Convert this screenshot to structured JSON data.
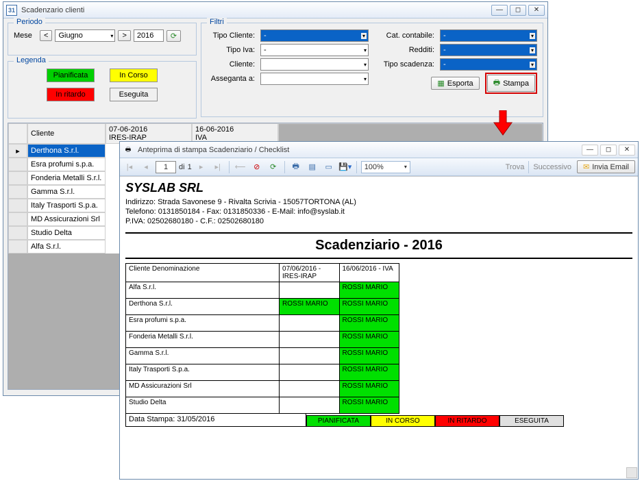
{
  "main": {
    "title": "Scadenzario clienti",
    "periodo": {
      "label": "Periodo",
      "mese_lbl": "Mese",
      "mese": "Giugno",
      "anno": "2016"
    },
    "legenda": {
      "label": "Legenda",
      "pianificata": "Pianificata",
      "incorso": "In Corso",
      "inritardo": "In ritardo",
      "eseguita": "Eseguita"
    },
    "filtri": {
      "label": "Filtri",
      "tipo_cliente": "Tipo Cliente:",
      "tipo_iva": "Tipo Iva:",
      "cliente": "Cliente:",
      "assegnata": "Asseganta a:",
      "cat_contabile": "Cat. contabile:",
      "redditi": "Redditi:",
      "tipo_scadenza": "Tipo scadenza:",
      "dash": "-"
    },
    "esporta": "Esporta",
    "stampa": "Stampa",
    "gridh": {
      "cliente": "Cliente",
      "c1a": "07-06-2016",
      "c1b": "IRES-IRAP",
      "c2a": "16-06-2016",
      "c2b": "IVA"
    },
    "rows": [
      "Derthona S.r.l.",
      "Esra profumi s.p.a.",
      "Fonderia Metalli  S.r.l.",
      "Gamma S.r.l.",
      "Italy Trasporti S.p.a.",
      "MD Assicurazioni Srl",
      "Studio Delta",
      "Alfa S.r.l."
    ]
  },
  "prev": {
    "title": "Anteprima di stampa Scadenziario / Checklist",
    "page_cur": "1",
    "di": "di",
    "page_tot": "1",
    "zoom": "100%",
    "trova": "Trova",
    "succ": "Successivo",
    "invia": "Invia Email",
    "company": "SYSLAB SRL",
    "addr": "Indirizzo: Strada Savonese 9 - Rivalta Scrivia - 15057TORTONA (AL)",
    "tel": "Telefono: 0131850184 - Fax: 0131850336 - E-Mail: info@syslab.it",
    "piva": "P.IVA: 02502680180 - C.F.: 02502680180",
    "heading": "Scadenziario -  2016",
    "th_cli": "Cliente Denominazione",
    "th1": "07/06/2016 - IRES-IRAP",
    "th2": "16/06/2016 - IVA",
    "rossi": "ROSSI MARIO",
    "rows": [
      "Alfa S.r.l.",
      "Derthona S.r.l.",
      "Esra profumi s.p.a.",
      "Fonderia Metalli  S.r.l.",
      "Gamma S.r.l.",
      "Italy Trasporti S.p.a.",
      "MD Assicurazioni Srl",
      "Studio Delta"
    ],
    "datastampa": "Data Stampa: 31/05/2016",
    "leg": {
      "p": "PIANIFICATA",
      "c": "IN CORSO",
      "r": "IN RITARDO",
      "e": "ESEGUITA"
    }
  }
}
